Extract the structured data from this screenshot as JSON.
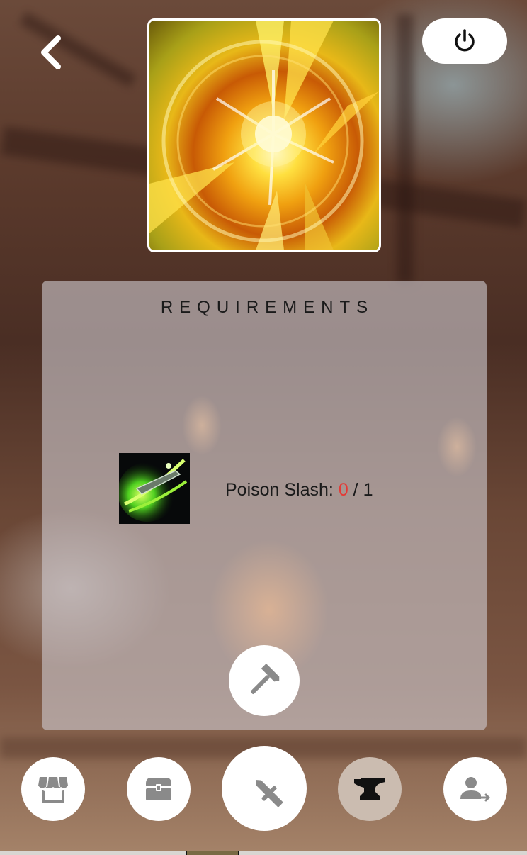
{
  "header": {
    "back_icon": "chevron-left-icon",
    "power_icon": "power-icon"
  },
  "skill_art": {
    "icon": "golden-burst-skill-art"
  },
  "requirements": {
    "title": "REQUIREMENTS",
    "items": [
      {
        "icon": "poison-slash-icon",
        "name": "Poison Slash:",
        "have": "0",
        "separator": " / ",
        "need": "1"
      }
    ]
  },
  "craft_button": {
    "icon": "hammer-icon"
  },
  "bottom_nav": {
    "items": [
      {
        "icon": "shop-icon",
        "active": false
      },
      {
        "icon": "chest-icon",
        "active": false
      },
      {
        "icon": "sword-icon",
        "active": false
      },
      {
        "icon": "anvil-icon",
        "active": true
      },
      {
        "icon": "user-logout-icon",
        "active": false
      }
    ]
  },
  "colors": {
    "requirement_missing": "#e53935",
    "active_nav": "#cbbcb0",
    "icon_gray": "#8a8a8a"
  }
}
